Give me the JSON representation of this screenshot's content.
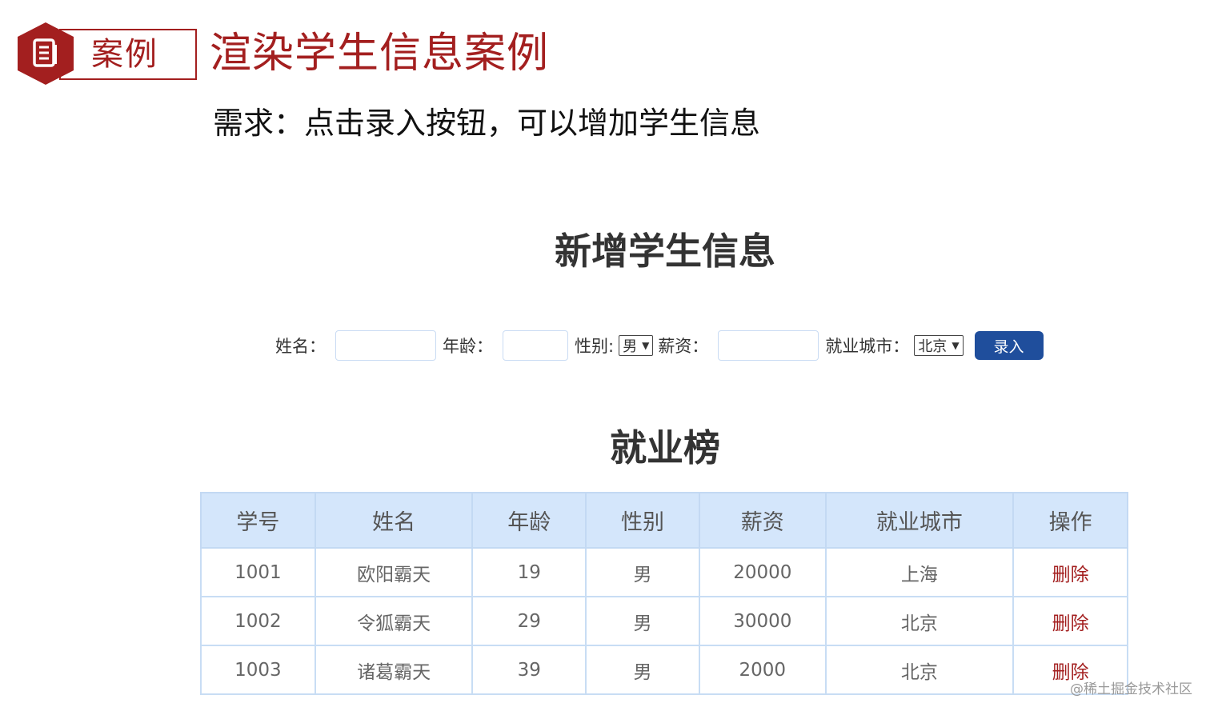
{
  "badge": {
    "label": "案例",
    "icon": "document-icon"
  },
  "slide_title": "渲染学生信息案例",
  "requirement": "需求：点击录入按钮，可以增加学生信息",
  "form": {
    "heading": "新增学生信息",
    "name_label": "姓名：",
    "name_value": "",
    "age_label": "年龄：",
    "age_value": "",
    "gender_label": "性别:",
    "gender_selected": "男",
    "salary_label": "薪资：",
    "salary_value": "",
    "city_label": "就业城市：",
    "city_selected": "北京",
    "submit_label": "录入"
  },
  "table": {
    "heading": "就业榜",
    "columns": [
      "学号",
      "姓名",
      "年龄",
      "性别",
      "薪资",
      "就业城市",
      "操作"
    ],
    "rows": [
      [
        "1001",
        "欧阳霸天",
        "19",
        "男",
        "20000",
        "上海",
        "删除"
      ],
      [
        "1002",
        "令狐霸天",
        "29",
        "男",
        "30000",
        "北京",
        "删除"
      ],
      [
        "1003",
        "诸葛霸天",
        "39",
        "男",
        "2000",
        "北京",
        "删除"
      ]
    ]
  },
  "watermark": "@稀土掘金技术社区",
  "colors": {
    "accent_red": "#a31f1f",
    "button_blue": "#1f4e9c",
    "header_blue": "#d4e6fb"
  }
}
